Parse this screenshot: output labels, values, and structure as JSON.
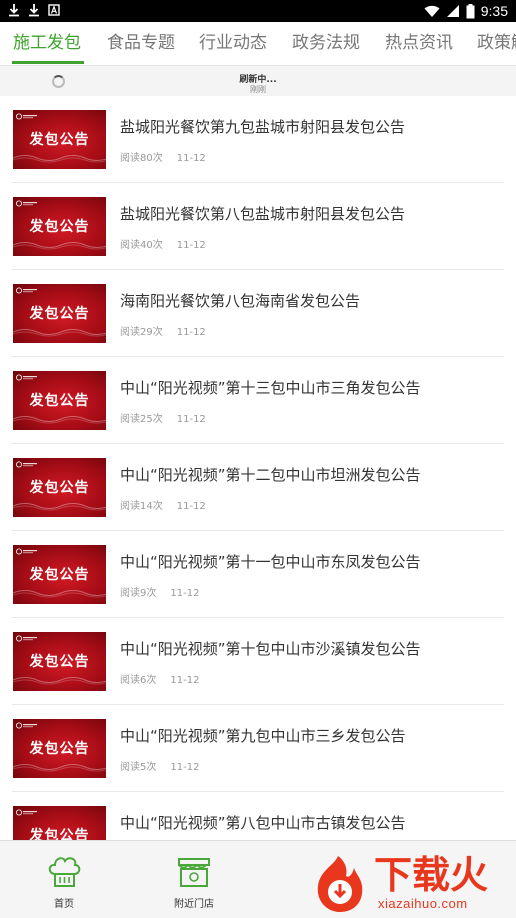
{
  "status_bar": {
    "time": "9:35",
    "left_icons": [
      "download-icon",
      "download-icon",
      "app-a-icon"
    ],
    "right_icons": [
      "wifi-icon",
      "signal-icon",
      "battery-icon"
    ]
  },
  "tabs": [
    {
      "label": "施工发包",
      "active": true
    },
    {
      "label": "食品专题",
      "active": false
    },
    {
      "label": "行业动态",
      "active": false
    },
    {
      "label": "政务法规",
      "active": false
    },
    {
      "label": "热点资讯",
      "active": false
    },
    {
      "label": "政策解",
      "active": false
    }
  ],
  "refresh": {
    "title": "刷新中...",
    "subtitle": "刚刚"
  },
  "items": [
    {
      "thumb_text": "发包公告",
      "title": "盐城阳光餐饮第九包盐城市射阳县发包公告",
      "reads": "阅读80次",
      "date": "11-12"
    },
    {
      "thumb_text": "发包公告",
      "title": "盐城阳光餐饮第八包盐城市射阳县发包公告",
      "reads": "阅读40次",
      "date": "11-12"
    },
    {
      "thumb_text": "发包公告",
      "title": "海南阳光餐饮第八包海南省发包公告",
      "reads": "阅读29次",
      "date": "11-12"
    },
    {
      "thumb_text": "发包公告",
      "title": "中山“阳光视频”第十三包中山市三角发包公告",
      "reads": "阅读25次",
      "date": "11-12"
    },
    {
      "thumb_text": "发包公告",
      "title": "中山“阳光视频”第十二包中山市坦洲发包公告",
      "reads": "阅读14次",
      "date": "11-12"
    },
    {
      "thumb_text": "发包公告",
      "title": "中山“阳光视频”第十一包中山市东凤发包公告",
      "reads": "阅读9次",
      "date": "11-12"
    },
    {
      "thumb_text": "发包公告",
      "title": "中山“阳光视频”第十包中山市沙溪镇发包公告",
      "reads": "阅读6次",
      "date": "11-12"
    },
    {
      "thumb_text": "发包公告",
      "title": "中山“阳光视频”第九包中山市三乡发包公告",
      "reads": "阅读5次",
      "date": "11-12"
    },
    {
      "thumb_text": "发包公告",
      "title": "中山“阳光视频”第八包中山市古镇发包公告",
      "reads": "",
      "date": ""
    }
  ],
  "bottom_nav": [
    {
      "label": "首页",
      "icon": "chef-hat-icon"
    },
    {
      "label": "附近门店",
      "icon": "store-icon"
    }
  ],
  "watermark": {
    "text": "下载火",
    "url": "xiazaihuo.com"
  },
  "colors": {
    "accent": "#3fa32e",
    "thumb_red": "#c1121d",
    "watermark": "#e8371c"
  }
}
